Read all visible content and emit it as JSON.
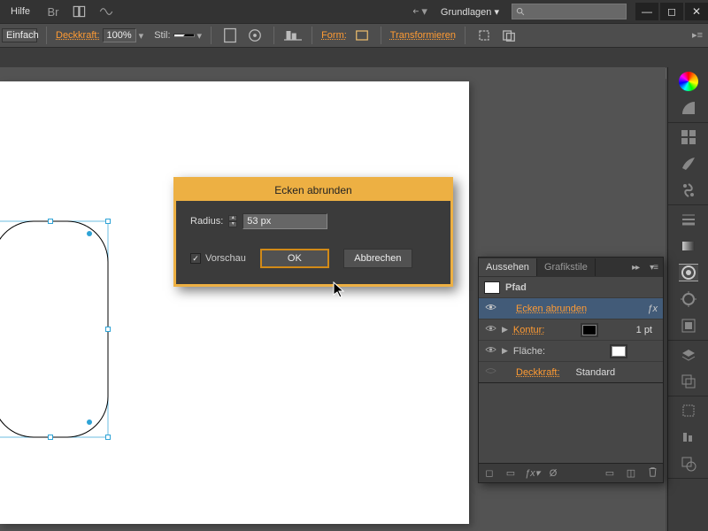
{
  "titlebar": {
    "help": "Hilfe",
    "workspace": "Grundlagen",
    "search_placeholder": ""
  },
  "optionbar": {
    "stroke_style": "Einfach",
    "opacity_label": "Deckkraft:",
    "opacity_value": "100%",
    "style_label": "Stil:",
    "shape_label": "Form:",
    "transform_label": "Transformieren"
  },
  "modal": {
    "title": "Ecken abrunden",
    "radius_label": "Radius:",
    "radius_value": "53 px",
    "preview_label": "Vorschau",
    "preview_checked": true,
    "ok": "OK",
    "cancel": "Abbrechen"
  },
  "panel": {
    "tabs": {
      "appearance": "Aussehen",
      "graphic_styles": "Grafikstile"
    },
    "path_label": "Pfad",
    "effect_label": "Ecken abrunden",
    "stroke_label": "Kontur:",
    "stroke_value": "1 pt",
    "fill_label": "Fläche:",
    "opacity_label": "Deckkraft:",
    "opacity_value": "Standard"
  },
  "colors": {
    "accent_orange": "#ff9b33",
    "dialog_border": "#edb043",
    "selection_blue": "#2ea3d6",
    "row_select": "#425b78"
  }
}
